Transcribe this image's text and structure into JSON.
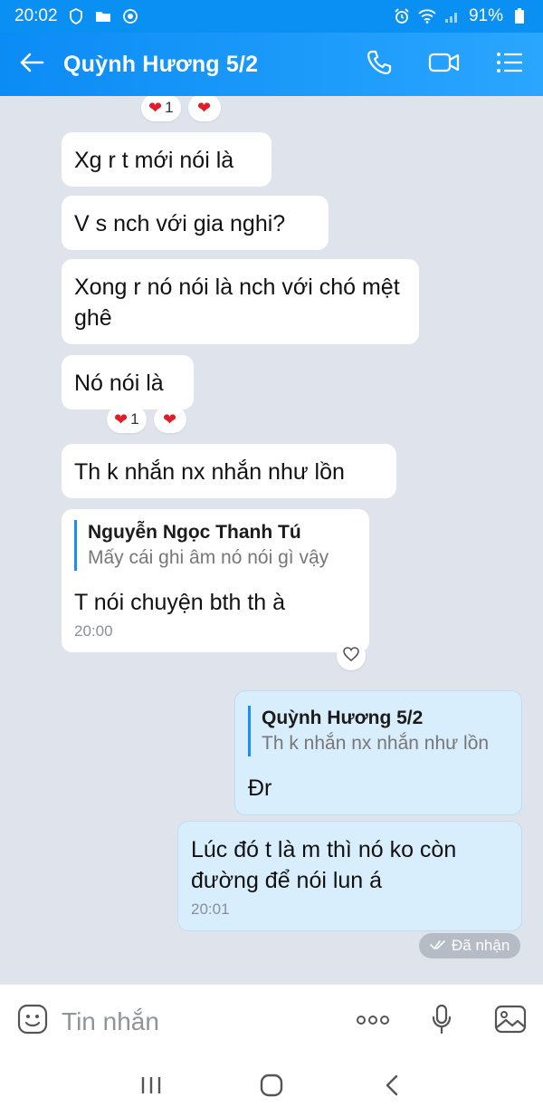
{
  "status_bar": {
    "time": "20:02",
    "battery": "91%"
  },
  "header": {
    "title": "Quỳnh Hương 5/2"
  },
  "messages": [
    {
      "text": "Xg r t mới nói là"
    },
    {
      "text": "V s nch với gia nghi?"
    },
    {
      "text": "Xong r nó nói là nch với chó mệt ghê"
    },
    {
      "text": "Nó nói là"
    },
    {
      "text": "Th k nhắn nx nhắn như lồn"
    },
    {
      "quote_name": "Nguyễn Ngọc Thanh Tú",
      "quote_text": "Mấy cái ghi âm nó nói gì vậy",
      "text": "T nói chuyện bth th à",
      "time": "20:00"
    },
    {
      "quote_name": "Quỳnh Hương 5/2",
      "quote_text": "Th k nhắn nx nhắn như lồn",
      "text": "Đr"
    },
    {
      "text": "Lúc đó t là m thì nó ko còn đường để nói lun á",
      "time": "20:01"
    }
  ],
  "reactions": {
    "top_count": "1",
    "mid_count": "1"
  },
  "delivery_status": "Đã nhận",
  "input": {
    "placeholder": "Tin nhắn"
  },
  "colors": {
    "header": "#0b8cf5",
    "my_bubble": "#d9eefc",
    "heart": "#e11d2a"
  }
}
